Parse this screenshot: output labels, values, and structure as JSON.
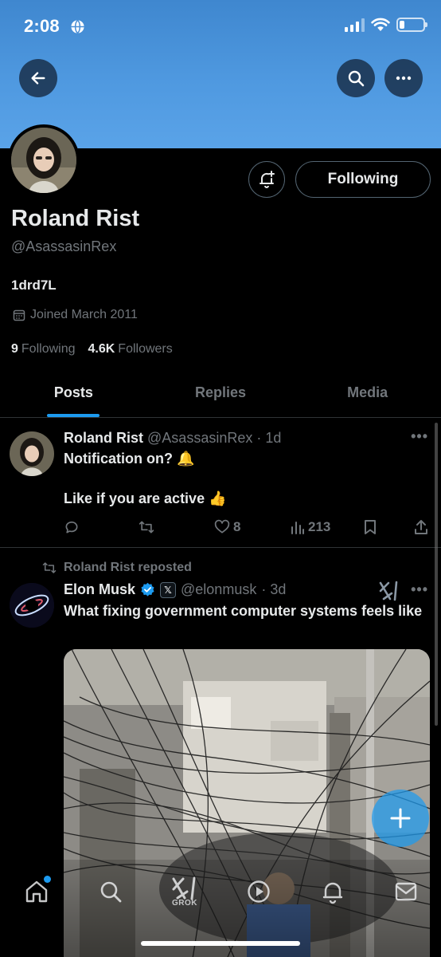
{
  "status_bar": {
    "time": "2:08",
    "battery_level": 0.22
  },
  "profile": {
    "name": "Roland Rist",
    "handle": "@AsassasinRex",
    "bio": "1drd7L",
    "joined": "Joined March 2011",
    "following_count": "9",
    "following_label": "Following",
    "followers_count": "4.6K",
    "followers_label": "Followers",
    "follow_button_label": "Following"
  },
  "tabs": [
    {
      "label": "Posts",
      "active": true
    },
    {
      "label": "Replies",
      "active": false
    },
    {
      "label": "Media",
      "active": false
    }
  ],
  "posts": [
    {
      "author": "Roland Rist",
      "handle": "@AsassasinRex",
      "time": "· 1d",
      "line1": "Notification on? 🔔",
      "line2": "Like if you are active 👍",
      "likes": "8",
      "views": "213"
    },
    {
      "repost_label": "Roland Rist reposted",
      "author": "Elon Musk",
      "handle": "@elonmusk",
      "time": "· 3d",
      "text": "What fixing government computer systems feels like"
    }
  ],
  "bottom_nav": {
    "grok_label": "GROK"
  },
  "colors": {
    "accent": "#1d9bf0",
    "banner": "#4f99e0",
    "background": "#000000",
    "secondary_text": "#71767b"
  },
  "icons": {
    "back": "arrow-left-icon",
    "search": "search-icon",
    "more": "more-horizontal-icon",
    "notifications": "bell-plus-icon",
    "calendar": "calendar-icon",
    "reply": "reply-icon",
    "repost": "repost-icon",
    "like": "heart-icon",
    "views": "views-icon",
    "bookmark": "bookmark-icon",
    "share": "share-icon",
    "verified": "verified-badge-icon",
    "grok": "grok-icon"
  }
}
